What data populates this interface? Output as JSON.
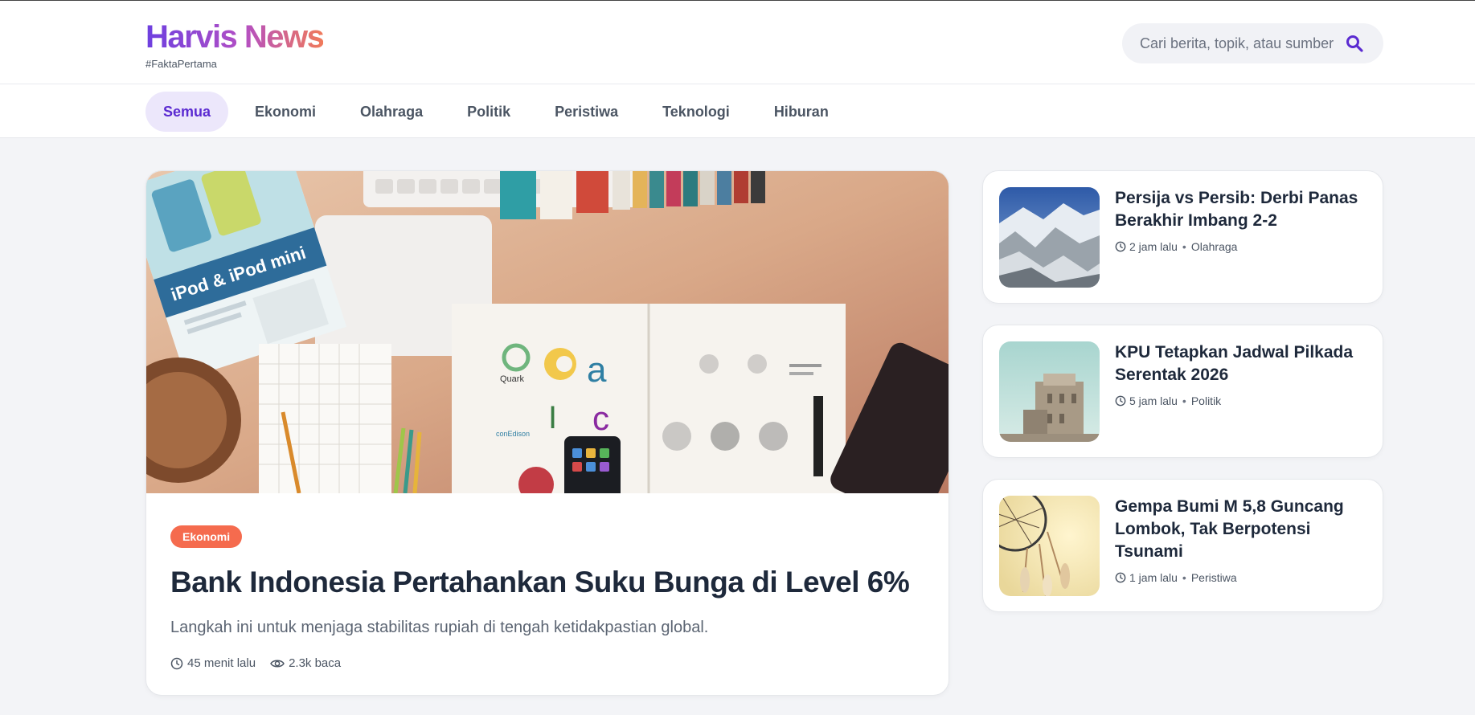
{
  "brand": {
    "name": "Harvis News",
    "tagline": "#FaktaPertama"
  },
  "search": {
    "placeholder": "Cari berita, topik, atau sumber",
    "icon": "search-icon"
  },
  "nav": {
    "items": [
      {
        "label": "Semua",
        "active": true
      },
      {
        "label": "Ekonomi"
      },
      {
        "label": "Olahraga"
      },
      {
        "label": "Politik"
      },
      {
        "label": "Peristiwa"
      },
      {
        "label": "Teknologi"
      },
      {
        "label": "Hiburan"
      }
    ]
  },
  "featured": {
    "category": "Ekonomi",
    "title": "Bank Indonesia Pertahankan Suku Bunga di Level 6%",
    "description": "Langkah ini untuk menjaga stabilitas rupiah di tengah ketidakpastian global.",
    "time": "45 menit lalu",
    "views": "2.3k baca",
    "image_text": {
      "ipod": "iPod & iPod mini",
      "quark": "Quark",
      "conedison": "conEdison"
    }
  },
  "side": [
    {
      "title": "Persija vs Persib: Derbi Panas Berakhir Imbang 2-2",
      "time": "2 jam lalu",
      "category": "Olahraga"
    },
    {
      "title": "KPU Tetapkan Jadwal Pilkada Serentak 2026",
      "time": "5 jam lalu",
      "category": "Politik"
    },
    {
      "title": "Gempa Bumi M 5,8 Guncang Lombok, Tak Berpotensi Tsunami",
      "time": "1 jam lalu",
      "category": "Peristiwa"
    }
  ],
  "colors": {
    "accent": "#5b2bd1",
    "badge": "#f56b4e",
    "background": "#f3f4f7"
  }
}
